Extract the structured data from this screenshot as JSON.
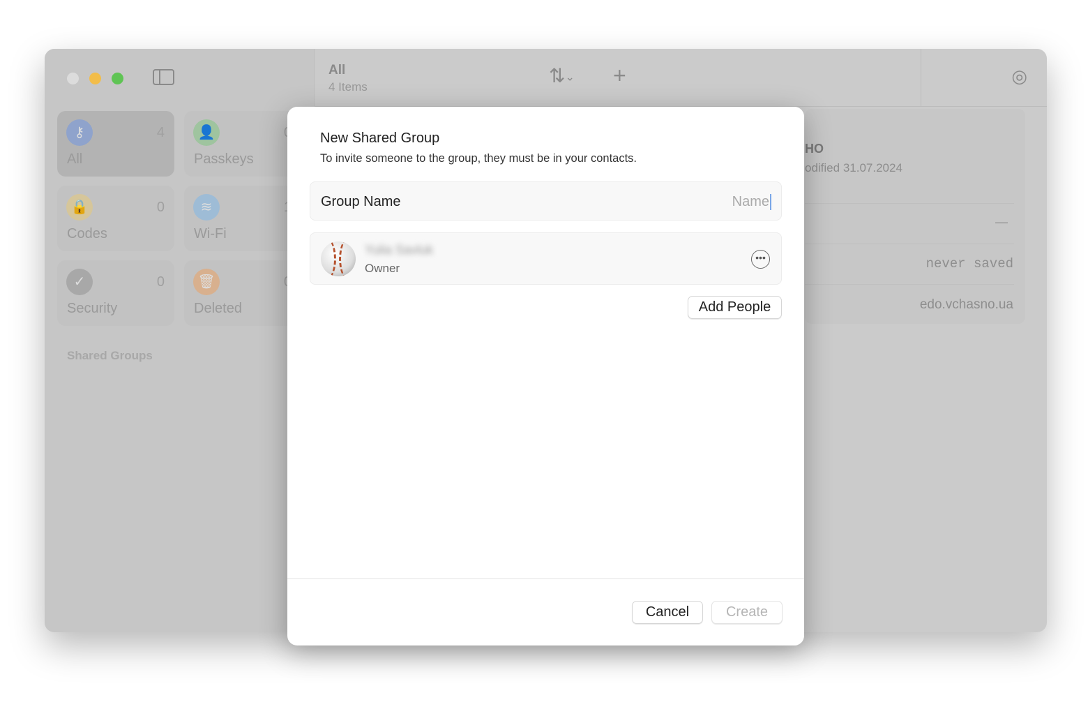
{
  "sidebar": {
    "categories": [
      {
        "label": "All",
        "count": "4",
        "icon": "key-icon",
        "color": "#8fa3cc"
      },
      {
        "label": "Passkeys",
        "count": "0",
        "icon": "person-key-icon",
        "color": "#9fc49f"
      },
      {
        "label": "Codes",
        "count": "0",
        "icon": "lock-clock-icon",
        "color": "#d6c69a"
      },
      {
        "label": "Wi-Fi",
        "count": "1",
        "icon": "wifi-icon",
        "color": "#9ebcd6"
      },
      {
        "label": "Security",
        "count": "0",
        "icon": "checkmark-icon",
        "color": "#a8a8a8"
      },
      {
        "label": "Deleted",
        "count": "0",
        "icon": "trash-icon",
        "color": "#d8b08e"
      }
    ],
    "section": "Shared Groups"
  },
  "toolbar": {
    "title": "All",
    "subtitle": "4 Items"
  },
  "detail": {
    "title": "HO",
    "modified": "odified 31.07.2024",
    "dash": "—",
    "never_saved": "never saved",
    "website": "edo.vchasno.ua"
  },
  "dialog": {
    "title": "New Shared Group",
    "subtitle": "To invite someone to the group, they must be in your contacts.",
    "group_name_label": "Group Name",
    "group_name_placeholder": "Name",
    "member": {
      "name": "Yulia Savluk",
      "role": "Owner"
    },
    "add_people": "Add People",
    "cancel": "Cancel",
    "create": "Create"
  }
}
